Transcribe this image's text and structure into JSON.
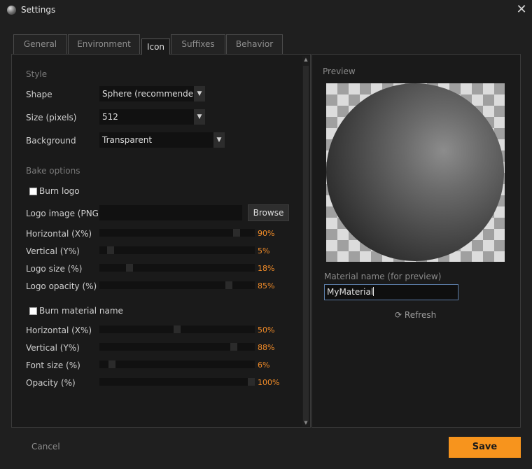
{
  "window": {
    "title": "Settings",
    "close_glyph": "✕"
  },
  "tabs": [
    {
      "label": "General"
    },
    {
      "label": "Environment"
    },
    {
      "label": "Icon"
    },
    {
      "label": "Suffixes"
    },
    {
      "label": "Behavior"
    }
  ],
  "active_tab": "Icon",
  "style": {
    "title": "Style",
    "shape": {
      "label": "Shape",
      "value": "Sphere (recommended"
    },
    "size": {
      "label": "Size (pixels)",
      "value": "512"
    },
    "background": {
      "label": "Background",
      "value": "Transparent"
    }
  },
  "bake": {
    "title": "Bake options",
    "burn_logo": {
      "label": "Burn logo",
      "checked": false
    },
    "logo_image": {
      "label": "Logo image (PNG)",
      "value": "",
      "browse_label": "Browse"
    },
    "logo_sliders": [
      {
        "label": "Horizontal (X%)",
        "value": 90,
        "value_label": "90%"
      },
      {
        "label": "Vertical (Y%)",
        "value": 5,
        "value_label": "5%"
      },
      {
        "label": "Logo size (%)",
        "value": 18,
        "value_label": "18%"
      },
      {
        "label": "Logo opacity (%)",
        "value": 85,
        "value_label": "85%"
      }
    ],
    "burn_material": {
      "label": "Burn material name",
      "checked": false
    },
    "material_sliders": [
      {
        "label": "Horizontal (X%)",
        "value": 50,
        "value_label": "50%"
      },
      {
        "label": "Vertical (Y%)",
        "value": 88,
        "value_label": "88%"
      },
      {
        "label": "Font size (%)",
        "value": 6,
        "value_label": "6%"
      },
      {
        "label": "Opacity (%)",
        "value": 100,
        "value_label": "100%"
      }
    ]
  },
  "preview": {
    "title": "Preview",
    "material_label": "Material name (for preview)",
    "material_value": "MyMaterial",
    "refresh_label": "Refresh",
    "refresh_glyph": "⟳"
  },
  "footer": {
    "cancel_label": "Cancel",
    "save_label": "Save"
  },
  "colors": {
    "accent": "#f7941d",
    "value_text": "#f28c28",
    "focus_border": "#5c7da8"
  },
  "icons": {
    "dropdown": "▼",
    "scroll_up": "▲",
    "scroll_down": "▼"
  }
}
